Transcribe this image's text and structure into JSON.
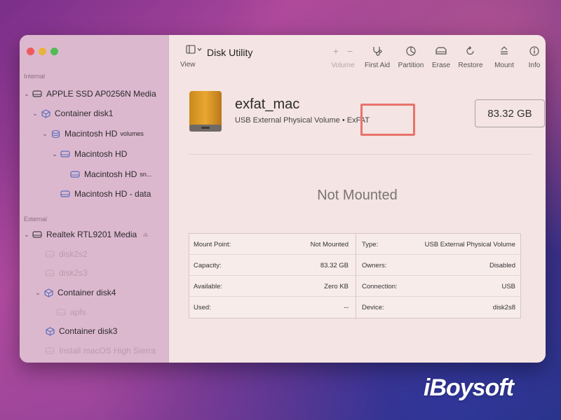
{
  "app": {
    "title": "Disk Utility"
  },
  "sidebar": {
    "internal_label": "Internal",
    "external_label": "External",
    "items": [
      {
        "label": "APPLE SSD AP0256N Media"
      },
      {
        "label": "Container disk1"
      },
      {
        "label": "Macintosh HD",
        "suffix": "volumes"
      },
      {
        "label": "Macintosh HD"
      },
      {
        "label": "Macintosh HD",
        "suffix": "sn..."
      },
      {
        "label": "Macintosh HD - data"
      },
      {
        "label": "Realtek RTL9201 Media"
      },
      {
        "label": "disk2s2"
      },
      {
        "label": "disk2s3"
      },
      {
        "label": "Container disk4"
      },
      {
        "label": "apfs"
      },
      {
        "label": "Container disk3"
      },
      {
        "label": "Install macOS High Sierra"
      }
    ]
  },
  "toolbar": {
    "view": "View",
    "volume": "Volume",
    "first_aid": "First Aid",
    "partition": "Partition",
    "erase": "Erase",
    "restore": "Restore",
    "mount": "Mount",
    "info": "Info",
    "add_glyph": "+",
    "remove_glyph": "−"
  },
  "volume": {
    "name": "exfat_mac",
    "subtitle_type": "USB External Physical Volume",
    "subtitle_sep": " • ",
    "format": "ExFAT",
    "size": "83.32 GB",
    "state": "Not Mounted"
  },
  "info": {
    "left": [
      {
        "key": "Mount Point:",
        "value": "Not Mounted"
      },
      {
        "key": "Capacity:",
        "value": "83.32 GB"
      },
      {
        "key": "Available:",
        "value": "Zero KB"
      },
      {
        "key": "Used:",
        "value": "--"
      }
    ],
    "right": [
      {
        "key": "Type:",
        "value": "USB External Physical Volume"
      },
      {
        "key": "Owners:",
        "value": "Disabled"
      },
      {
        "key": "Connection:",
        "value": "USB"
      },
      {
        "key": "Device:",
        "value": "disk2s8"
      }
    ]
  },
  "watermark": "iBoysoft",
  "colors": {
    "highlight": "#e8736a",
    "sidebar": "#dcb8cf",
    "window": "#f4e4e3"
  }
}
